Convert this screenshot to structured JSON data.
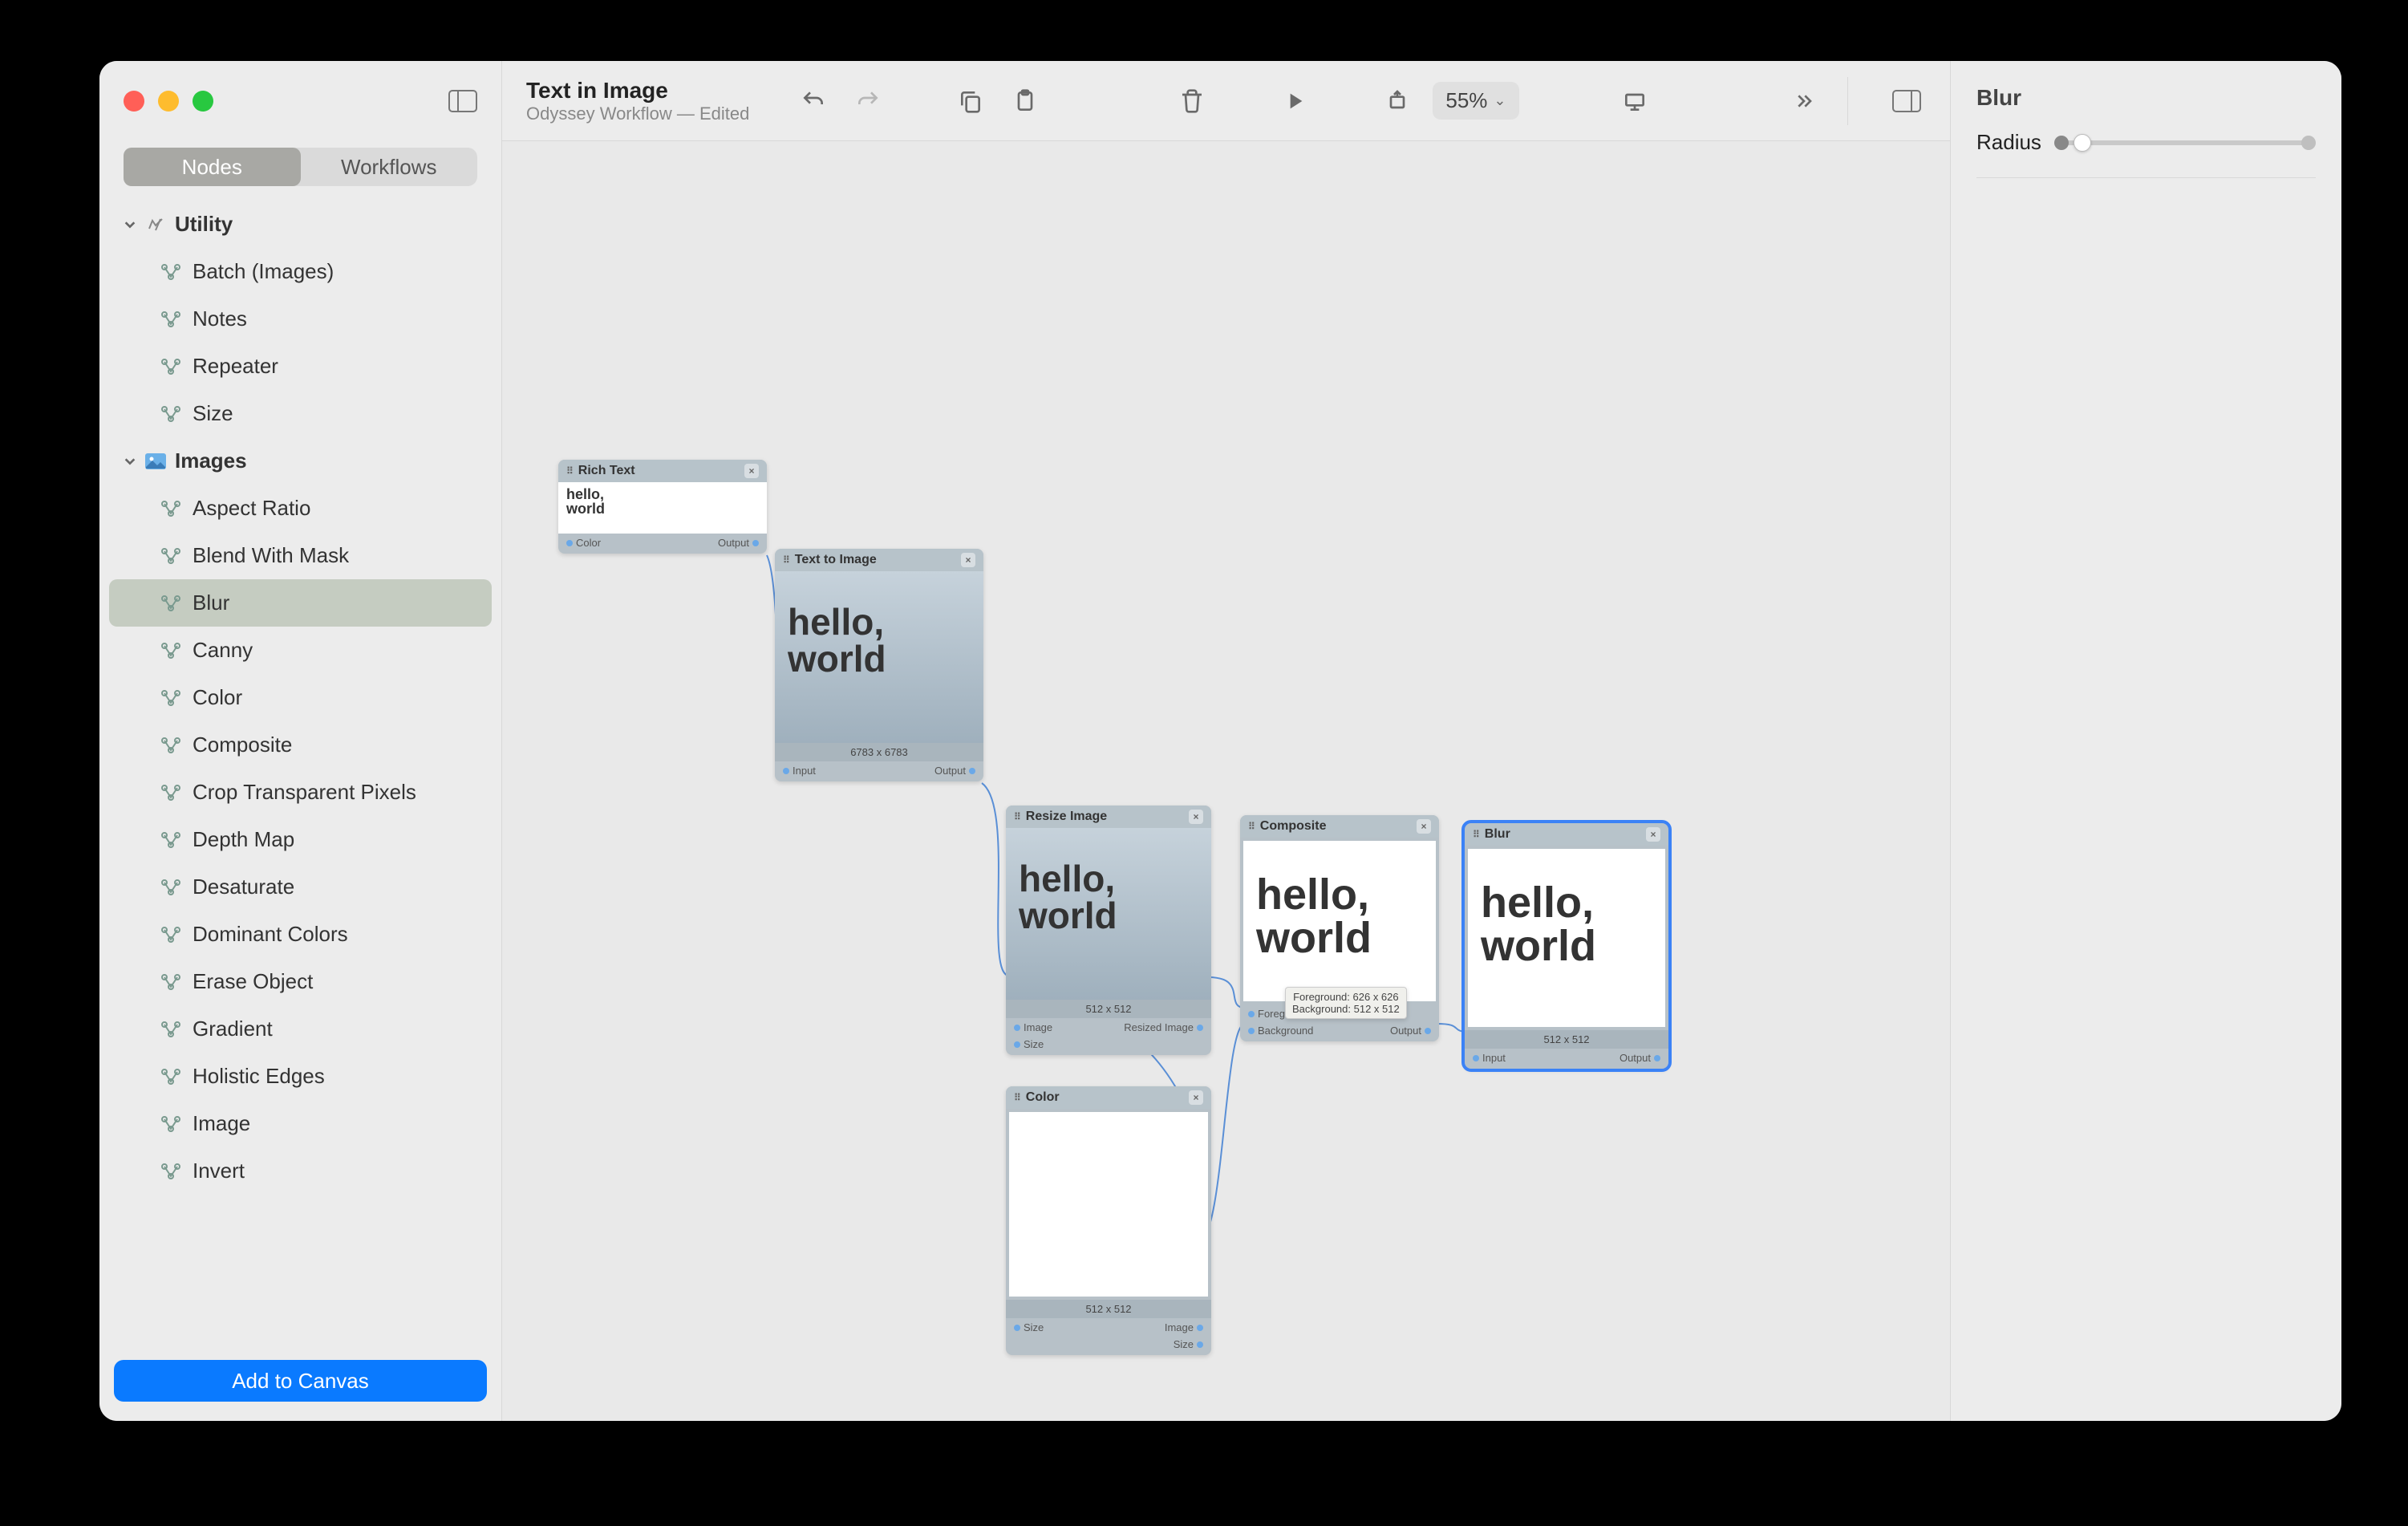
{
  "app": {
    "title": "Text in Image",
    "subtitle": "Odyssey Workflow  —  Edited",
    "zoom": "55%"
  },
  "tabs": {
    "nodes": "Nodes",
    "workflows": "Workflows"
  },
  "sidebar": {
    "sections": [
      {
        "title": "Utility",
        "items": [
          "Batch (Images)",
          "Notes",
          "Repeater",
          "Size"
        ],
        "icon": "utility"
      },
      {
        "title": "Images",
        "items": [
          "Aspect Ratio",
          "Blend With Mask",
          "Blur",
          "Canny",
          "Color",
          "Composite",
          "Crop Transparent Pixels",
          "Depth Map",
          "Desaturate",
          "Dominant Colors",
          "Erase Object",
          "Gradient",
          "Holistic Edges",
          "Image",
          "Invert"
        ],
        "icon": "images",
        "selected": 2
      }
    ],
    "add_button": "Add to Canvas"
  },
  "inspector": {
    "title": "Blur",
    "radius_label": "Radius"
  },
  "canvas": {
    "preview_text": "hello,\nworld",
    "nodes": {
      "rich_text": {
        "title": "Rich Text",
        "out": "Output",
        "in": "Color"
      },
      "text_to_image": {
        "title": "Text to Image",
        "dims": "6783 x 6783",
        "in": "Input",
        "out": "Output"
      },
      "resize": {
        "title": "Resize Image",
        "dims": "512 x 512",
        "in1": "Image",
        "in2": "Size",
        "out": "Resized Image"
      },
      "color": {
        "title": "Color",
        "dims": "512 x 512",
        "in": "Size",
        "out1": "Image",
        "out2": "Size"
      },
      "composite": {
        "title": "Composite",
        "in1": "Foreground",
        "in2": "Background",
        "out": "Output",
        "tooltip": "Foreground: 626 x 626\nBackground: 512 x 512"
      },
      "blur": {
        "title": "Blur",
        "dims": "512 x 512",
        "in": "Input",
        "out": "Output"
      }
    }
  }
}
